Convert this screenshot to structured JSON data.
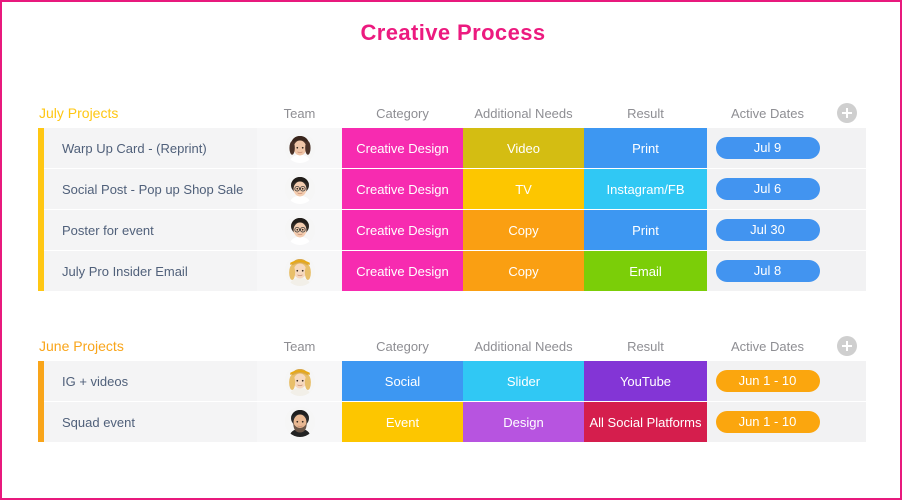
{
  "page": {
    "title": "Creative Process",
    "border_color": "#e8197d",
    "title_color": "#ec1a7f"
  },
  "add_button": {
    "icon": "plus-icon",
    "label": "+"
  },
  "sections": [
    {
      "id": "july",
      "section_label": "July Projects",
      "section_color": "#ffc713",
      "accent_color": "#ffc713",
      "columns": [
        "Team",
        "Category",
        "Additional Needs",
        "Result",
        "Active Dates"
      ],
      "rows": [
        {
          "name": "Warp Up Card - (Reprint)",
          "avatar": "avatar-woman-brown-hair",
          "category": {
            "label": "Creative Design",
            "color": "#f72bb0"
          },
          "needs": {
            "label": "Video",
            "color": "#d4bd12"
          },
          "result": {
            "label": "Print",
            "color": "#3d97f2"
          },
          "date": {
            "label": "Jul 9",
            "color": "#4294f0"
          }
        },
        {
          "name": "Social Post - Pop up Shop Sale",
          "avatar": "avatar-person-glasses",
          "category": {
            "label": "Creative Design",
            "color": "#f72bb0"
          },
          "needs": {
            "label": "TV",
            "color": "#fdc600"
          },
          "result": {
            "label": "Instagram/FB",
            "color": "#30c8f4"
          },
          "date": {
            "label": "Jul 6",
            "color": "#4294f0"
          }
        },
        {
          "name": "Poster for event",
          "avatar": "avatar-person-glasses",
          "category": {
            "label": "Creative Design",
            "color": "#f72bb0"
          },
          "needs": {
            "label": "Copy",
            "color": "#fa9f12"
          },
          "result": {
            "label": "Print",
            "color": "#3d97f2"
          },
          "date": {
            "label": "Jul 30",
            "color": "#4294f0"
          }
        },
        {
          "name": "July Pro Insider Email",
          "avatar": "avatar-woman-blonde-headband",
          "category": {
            "label": "Creative Design",
            "color": "#f72bb0"
          },
          "needs": {
            "label": "Copy",
            "color": "#fa9f12"
          },
          "result": {
            "label": "Email",
            "color": "#7bce08"
          },
          "date": {
            "label": "Jul 8",
            "color": "#4294f0"
          }
        }
      ]
    },
    {
      "id": "june",
      "section_label": "June Projects",
      "section_color": "#f9a51a",
      "accent_color": "#f9a51a",
      "columns": [
        "Team",
        "Category",
        "Additional Needs",
        "Result",
        "Active Dates"
      ],
      "rows": [
        {
          "name": "IG + videos",
          "avatar": "avatar-woman-blonde-headband",
          "category": {
            "label": "Social",
            "color": "#3d97f2"
          },
          "needs": {
            "label": "Slider",
            "color": "#30c8f4"
          },
          "result": {
            "label": "YouTube",
            "color": "#8335d6"
          },
          "date": {
            "label": "Jun 1 - 10",
            "color": "#fba60e"
          }
        },
        {
          "name": "Squad event",
          "avatar": "avatar-man-beard",
          "category": {
            "label": "Event",
            "color": "#fdc600"
          },
          "needs": {
            "label": "Design",
            "color": "#b754e0"
          },
          "result": {
            "label": "All Social Platforms",
            "color": "#d51e4d"
          },
          "date": {
            "label": "Jun 1 - 10",
            "color": "#fba60e"
          }
        }
      ]
    }
  ]
}
